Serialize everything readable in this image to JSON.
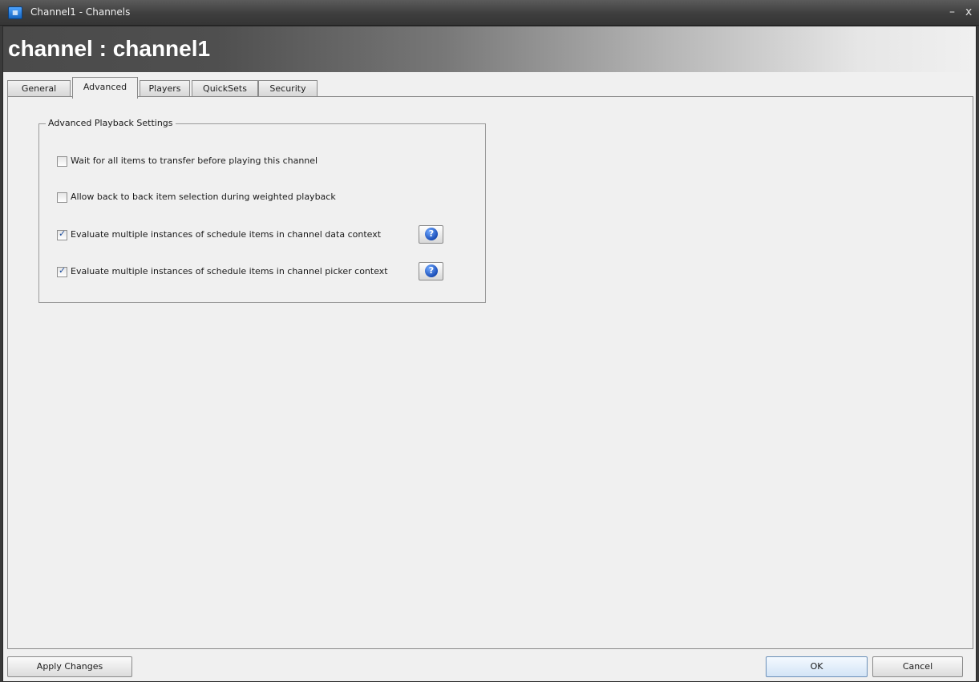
{
  "window": {
    "icon": "channels-app-icon",
    "icon_glyph": "▦",
    "title": "Channel1 - Channels",
    "minimize_glyph": "–",
    "close_glyph": "x"
  },
  "banner": {
    "title": "channel : channel1"
  },
  "tabs": [
    {
      "label": "General",
      "active": false
    },
    {
      "label": "Advanced",
      "active": true
    },
    {
      "label": "Players",
      "active": false
    },
    {
      "label": "QuickSets",
      "active": false
    },
    {
      "label": "Security",
      "active": false
    }
  ],
  "advanced": {
    "group_title": "Advanced Playback Settings",
    "options": [
      {
        "label": "Wait for all items to transfer before playing this channel",
        "checked": false,
        "has_help": false
      },
      {
        "label": "Allow back to back item selection during weighted playback",
        "checked": false,
        "has_help": false
      },
      {
        "label": "Evaluate multiple instances of schedule items in channel data context",
        "checked": true,
        "has_help": true
      },
      {
        "label": "Evaluate multiple instances of schedule items in channel picker context",
        "checked": true,
        "has_help": true
      }
    ],
    "help_glyph": "?"
  },
  "footer": {
    "apply_label": "Apply Changes",
    "ok_label": "OK",
    "cancel_label": "Cancel"
  },
  "colors": {
    "titlebar": "#3e3e3e",
    "banner_dark": "#4a4a4a",
    "panel_bg": "#f0f0f0",
    "check_accent": "#1f4f9e",
    "help_blue": "#1c4fb8"
  }
}
